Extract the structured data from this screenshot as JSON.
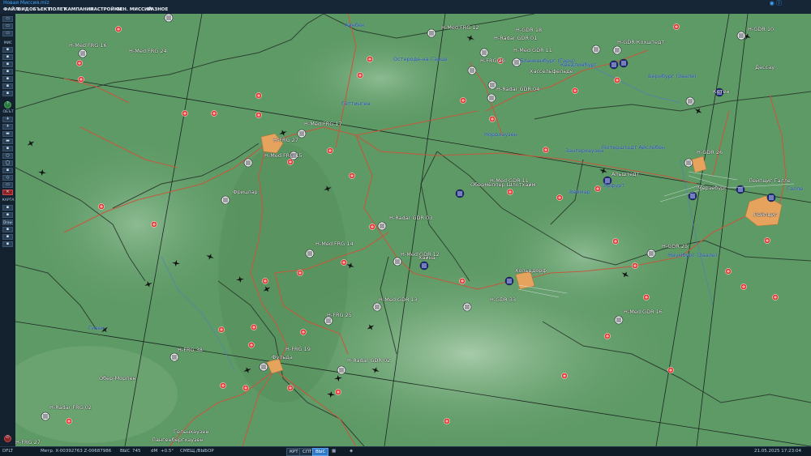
{
  "window": {
    "title": "Новая Миссия.miz"
  },
  "menu": [
    "ФАЙЛ",
    "ВИД",
    "ОБЪЕКТ",
    "ПОЛЕТ",
    "КАМПАНИЯ",
    "НАСТРОЙКИ",
    "ГЕН. МИССИЙ",
    "РАЗНОЕ"
  ],
  "sidebar": {
    "section_mis": "МИС",
    "section_obj": "ОБЪТ",
    "section_map": "КАРТА",
    "draw_label": "Draw",
    "help_icon": "?"
  },
  "statusbar": {
    "profile": "DFLT",
    "coords": "Метр.  X-00392763 Z-00687986",
    "alt_label": "ВЫС",
    "alt_value": "745",
    "dm_label": "dM",
    "dm_value": "+0.5°",
    "mode": "СМЕЩ./ВЫБОР",
    "btn_krt": "КРТ",
    "btn_spt": "СПТ",
    "btn_vys": "ВЫС",
    "datetime": "21.05.2025 17:23:04"
  },
  "colors": {
    "map_green": "#5e9a66",
    "road": "#c2573b",
    "border": "#1e2c26",
    "city": "#e8a15b",
    "spot": "#e63530"
  },
  "units": [
    {
      "name": "Н-Med FRG 16",
      "icon": "friendly-unit-icon"
    },
    {
      "name": "Н-Med FRG 24",
      "icon": "friendly-unit-icon"
    },
    {
      "name": "Н-Med FRG 12",
      "icon": "friendly-unit-icon"
    },
    {
      "name": "Н-Radar GDR 01",
      "icon": "friendly-unit-icon"
    },
    {
      "name": "Н-Med GDR 11",
      "icon": "friendly-unit-icon"
    },
    {
      "name": "Н-GDR 18",
      "icon": "friendly-unit-icon"
    },
    {
      "name": "Н-FRG 20",
      "icon": "friendly-unit-icon"
    },
    {
      "name": "Н-Radar GDR 04",
      "icon": "friendly-unit-icon"
    },
    {
      "name": "Н-GDR Кохштедт",
      "icon": "enemy-unit-icon"
    },
    {
      "name": "Н-GDR 10",
      "icon": "friendly-unit-icon"
    },
    {
      "name": "Н-Med FRG 17",
      "icon": "friendly-unit-icon"
    },
    {
      "name": "Н-FRG 27",
      "icon": "friendly-unit-icon"
    },
    {
      "name": "Н-Med FRG 15",
      "icon": "friendly-unit-icon"
    },
    {
      "name": "Н-GDR 26",
      "icon": "friendly-unit-icon"
    },
    {
      "name": "Котен",
      "icon": "enemy-unit-icon"
    },
    {
      "name": "Альштедт",
      "icon": "friendly-unit-icon"
    },
    {
      "name": "Обермёллер Шлотхайм",
      "icon": "enemy-unit-icon"
    },
    {
      "name": "Н-Med GDR 11",
      "icon": "friendly-unit-icon"
    },
    {
      "name": "Мерзебург",
      "icon": "enemy-unit-icon"
    },
    {
      "name": "Лейпциг Галле",
      "icon": "enemy-unit-icon"
    },
    {
      "name": "Н-Radar GDR 03",
      "icon": "friendly-unit-icon"
    },
    {
      "name": "Н-Med FRG 14",
      "icon": "friendly-unit-icon"
    },
    {
      "name": "Н-Med GDR 12",
      "icon": "friendly-unit-icon"
    },
    {
      "name": "Хайна",
      "icon": "enemy-unit-icon"
    },
    {
      "name": "Н-GDR 25",
      "icon": "friendly-unit-icon"
    },
    {
      "name": "Фрицлар",
      "icon": "friendly-unit-icon"
    },
    {
      "name": "Хольцдорф",
      "icon": "enemy-unit-icon"
    },
    {
      "name": "Н-Med GDR 13",
      "icon": "friendly-unit-icon"
    },
    {
      "name": "Н-GDR 33",
      "icon": "friendly-unit-icon"
    },
    {
      "name": "Н-Med GDR 16",
      "icon": "friendly-unit-icon"
    },
    {
      "name": "Н-FRG 25",
      "icon": "friendly-unit-icon"
    },
    {
      "name": "Н-FRG 38",
      "icon": "friendly-unit-icon"
    },
    {
      "name": "Н-FRG 19",
      "icon": "friendly-unit-icon"
    },
    {
      "name": "Фульда",
      "icon": "friendly-unit-icon"
    },
    {
      "name": "Н-Radar GDR 02",
      "icon": "friendly-unit-icon"
    },
    {
      "name": "Н-Radar FRG 02",
      "icon": "friendly-unit-icon"
    },
    {
      "name": "Н-FRG 27",
      "icon": "friendly-unit-icon"
    }
  ],
  "cities": [
    "Айнбек",
    "Остероде-на-Гарце",
    "Бланкенбург (Гарц)",
    "Кведлинбург",
    "Хассельфельде",
    "Дессау",
    "Бернбург (Заале)",
    "Гёттинген",
    "Нордхаузен",
    "Зангерхаузен",
    "Лютерштадт Айслебен",
    "Обер-Морлен",
    "Гизен",
    "Гельнхаузен",
    "Лангенбергхаузен",
    "Лейпциг",
    "Галле",
    "Веймар",
    "Эрфурт",
    "Наумбург (Заале)"
  ]
}
